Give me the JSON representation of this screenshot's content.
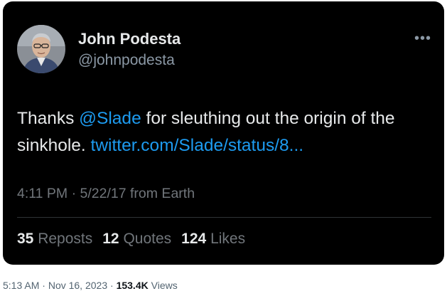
{
  "tweet": {
    "author_name": "John Podesta",
    "author_handle": "@johnpodesta",
    "more_icon": "more-horizontal-icon",
    "text_prefix": "Thanks ",
    "mention": "@Slade",
    "text_middle": " for sleuthing out the origin of the sinkhole. ",
    "link": "twitter.com/Slade/status/8...",
    "time": "4:11 PM",
    "separator": "·",
    "date": "5/22/17",
    "source": "from Earth",
    "stats": {
      "reposts_count": "35",
      "reposts_label": "Reposts",
      "quotes_count": "12",
      "quotes_label": "Quotes",
      "likes_count": "124",
      "likes_label": "Likes"
    }
  },
  "footer": {
    "time": "5:13 AM",
    "sep1": "·",
    "date": "Nov 16, 2023",
    "sep2": "·",
    "views_count": "153.4K",
    "views_label": "Views"
  },
  "colors": {
    "card_background": "#000000",
    "text_primary": "#e7e9ea",
    "text_secondary": "#71767b",
    "link": "#1d9bf0",
    "divider": "#2f3336"
  }
}
